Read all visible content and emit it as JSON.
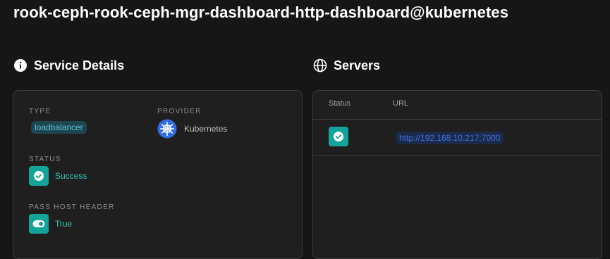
{
  "page": {
    "title": "rook-ceph-rook-ceph-mgr-dashboard-http-dashboard@kubernetes"
  },
  "service_details": {
    "heading": "Service Details",
    "icon": "info-icon",
    "type": {
      "label": "TYPE",
      "value": "loadbalancer"
    },
    "provider": {
      "label": "PROVIDER",
      "value": "Kubernetes",
      "icon": "kubernetes-logo"
    },
    "status": {
      "label": "STATUS",
      "value": "Success",
      "icon": "check-icon"
    },
    "pass_host_header": {
      "label": "PASS HOST HEADER",
      "value": "True",
      "icon": "toggle-icon"
    }
  },
  "servers": {
    "heading": "Servers",
    "icon": "globe-icon",
    "columns": [
      "Status",
      "URL"
    ],
    "rows": [
      {
        "status_icon": "check-icon",
        "url": "http://192.168.10.217:7000"
      }
    ]
  },
  "colors": {
    "background": "#161616",
    "card": "#1f1f1f",
    "success": "#14a39a",
    "success_text": "#2fc9b6",
    "link": "#3e6fe0",
    "kubernetes": "#326ce5"
  }
}
